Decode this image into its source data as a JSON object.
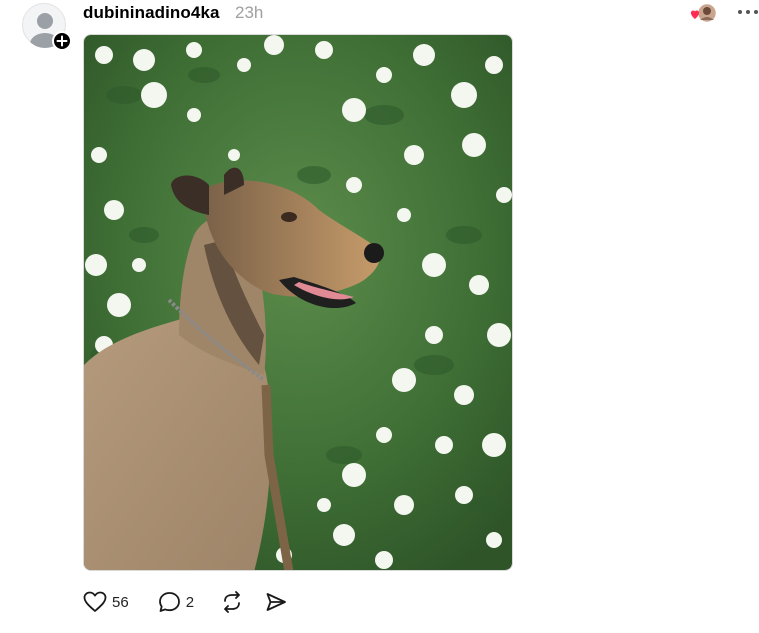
{
  "post": {
    "username": "dubininadino4ka",
    "time": "23h",
    "image_alt": "Dog sitting in front of a flowering white spirea bush",
    "likes": "56",
    "replies": "2"
  },
  "icons": {
    "avatar": "default-avatar-icon",
    "follow": "plus-icon",
    "menu": "more-horizontal-icon",
    "like": "heart-icon",
    "reply": "comment-icon",
    "repost": "repost-icon",
    "share": "send-icon"
  },
  "colors": {
    "like_heart": "#ff2d55",
    "muted_text": "#a0a0a0"
  }
}
